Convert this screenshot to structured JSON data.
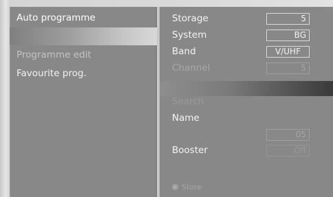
{
  "left_menu": {
    "items": [
      {
        "label": "Auto programme",
        "state": "active"
      },
      {
        "label": "Programme edit",
        "state": "faded"
      },
      {
        "label": "Favourite prog.",
        "state": "normal"
      }
    ]
  },
  "settings": {
    "storage": {
      "label": "Storage",
      "value": "5"
    },
    "system": {
      "label": "System",
      "value": "BG"
    },
    "band": {
      "label": "Band",
      "value": "V/UHF"
    },
    "channel": {
      "label": "Channel",
      "value": "5"
    },
    "search": {
      "label": "Search"
    },
    "name": {
      "label": "Name"
    },
    "fine": {
      "value": "05"
    },
    "booster": {
      "label": "Booster",
      "value": "Off"
    }
  },
  "store": {
    "label": "Store"
  },
  "colors": {
    "panel": "#888888",
    "text": "#f4f4f4",
    "faded_text": "#a8a8a8"
  }
}
